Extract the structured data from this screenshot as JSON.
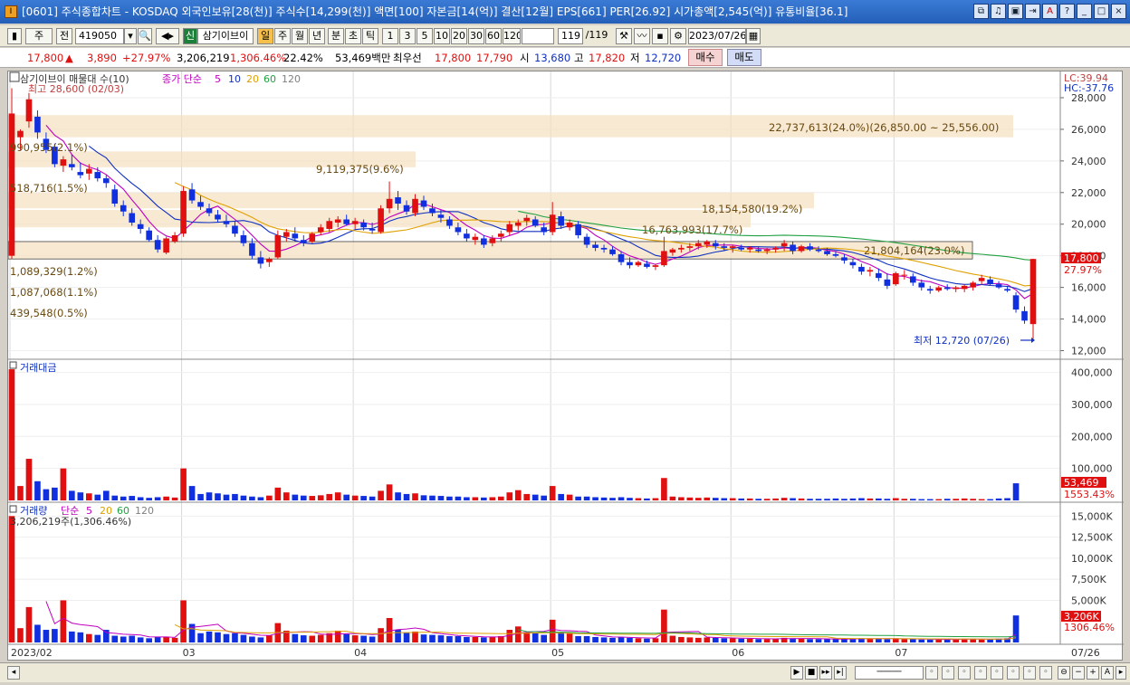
{
  "window": {
    "icon_label": "I",
    "title": "[0601] 주식종합차트 - KOSDAQ 외국인보유[28(천)] 주식수[14,299(천)] 액면[100] 자본금[14(억)] 결산[12월] EPS[661] PER[26.92] 시가총액[2,545(억)] 유통비율[36.1]",
    "buttons": [
      "⧉",
      "♫",
      "▣",
      "⇥",
      "A",
      "?",
      "_",
      "□",
      "×"
    ]
  },
  "toolbar": {
    "period_select": "주",
    "prev_label": "전",
    "code": "419050",
    "code_dropdown": "▾",
    "search": "🔍",
    "speaker": "◀▸",
    "credit_label": "신",
    "stock_name": "삼기이브이",
    "periods": [
      "일",
      "주",
      "월",
      "년",
      "분",
      "초",
      "틱"
    ],
    "selected_period": "일",
    "intervals": [
      "1",
      "3",
      "5",
      "10",
      "20",
      "30",
      "60",
      "120"
    ],
    "count": "119",
    "count_total": "/119",
    "date": "2023/07/26",
    "calendar": "▦"
  },
  "quote": {
    "price": "17,800",
    "arrow": "▲",
    "change": "3,890",
    "change_pct": "+27.97%",
    "volume": "3,206,219",
    "volume_ratio": "1,306.46%",
    "turnover": "22.42%",
    "amount": "53,469백만",
    "best_ask_label": "최우선",
    "best_ask": "17,800",
    "best_bid": "17,790",
    "open_label": "시",
    "open": "13,680",
    "high_label": "고",
    "high": "17,820",
    "low_label": "저",
    "low": "12,720",
    "buy": "매수",
    "sell": "매도"
  },
  "price_panel": {
    "legend_name": "삼기이브이 매물대 수(10)",
    "legend_ma": "종가 단순",
    "ma_periods": [
      "5",
      "10",
      "20",
      "60",
      "120"
    ],
    "ma_colors": [
      "#c000c0",
      "#1030c0",
      "#e0a000",
      "#20a040",
      "#808080"
    ],
    "high_marker": "최고 28,600 (02/03)",
    "low_marker": "최저 12,720 (07/26)",
    "lc": "LC:39.94",
    "hc": "HC:-37.76",
    "last_price_tag": "17,800",
    "last_pct_tag": "27.97%",
    "volume_profile_labels": [
      "22,737,613(24.0%)(26,850.00 ~ 25,556.00)",
      "9,119,375(9.6%)",
      "18,154,580(19.2%)",
      "16,763,993(17.7%)",
      "21,804,164(23.0%)"
    ],
    "left_profile_labels": [
      "990,955(2.1%)",
      "518,716(1.5%)",
      "1,089,329(1.2%)",
      "1,087,068(1.1%)",
      "439,548(0.5%)"
    ]
  },
  "amount_panel": {
    "title": "거래대금",
    "last_tag": "53,469",
    "last_pct": "1553.43%"
  },
  "volume_panel": {
    "legend_name": "거래량",
    "legend_ma": "단순",
    "ma_periods": [
      "5",
      "20",
      "60",
      "120"
    ],
    "last_label": "3,206,219주(1,306.46%)",
    "last_tag": "3,206K",
    "last_pct": "1306.46%"
  },
  "chart_data": {
    "type": "candlestick",
    "x_labels": [
      "2023/02",
      "03",
      "04",
      "05",
      "06",
      "07",
      "07/26"
    ],
    "price_axis": {
      "ticks": [
        12000,
        14000,
        16000,
        18000,
        20000,
        22000,
        24000,
        26000,
        28000
      ],
      "tick_labels": [
        "12,000",
        "14,000",
        "16,000",
        "18,000",
        "20,000",
        "22,000",
        "24,000",
        "26,000",
        "28,000"
      ],
      "range": [
        11800,
        29200
      ]
    },
    "amount_axis": {
      "ticks": [
        100000,
        200000,
        300000,
        400000
      ],
      "tick_labels": [
        "100,000",
        "200,000",
        "300,000",
        "400,000"
      ],
      "range": [
        0,
        430000
      ]
    },
    "volume_axis": {
      "ticks": [
        5000,
        7500,
        10000,
        12500,
        15000
      ],
      "tick_labels": [
        "5,000K",
        "7,500K",
        "10,000K",
        "12,500K",
        "15,000K"
      ],
      "range": [
        0,
        16000
      ]
    },
    "candles": [
      [
        18000,
        28600,
        17800,
        27000
      ],
      [
        25500,
        26000,
        24700,
        25900
      ],
      [
        26500,
        28300,
        26100,
        27900
      ],
      [
        26800,
        27200,
        25400,
        25800
      ],
      [
        25400,
        25800,
        24500,
        24700
      ],
      [
        24900,
        25100,
        23600,
        23800
      ],
      [
        23700,
        24300,
        23300,
        24100
      ],
      [
        23800,
        24400,
        23400,
        23600
      ],
      [
        23300,
        23900,
        22900,
        23100
      ],
      [
        23200,
        23800,
        22800,
        23500
      ],
      [
        23300,
        23600,
        22700,
        22900
      ],
      [
        22900,
        23100,
        22300,
        22600
      ],
      [
        22200,
        22500,
        21100,
        21300
      ],
      [
        21200,
        21500,
        20500,
        20800
      ],
      [
        20700,
        21000,
        19900,
        20100
      ],
      [
        20000,
        20300,
        19400,
        19700
      ],
      [
        19600,
        19800,
        18900,
        19000
      ],
      [
        19000,
        19300,
        18200,
        18400
      ],
      [
        18200,
        19200,
        18100,
        19100
      ],
      [
        18900,
        19500,
        18800,
        19300
      ],
      [
        19400,
        22400,
        19200,
        22100
      ],
      [
        22200,
        22600,
        21300,
        21500
      ],
      [
        21400,
        21800,
        20900,
        21100
      ],
      [
        21000,
        21300,
        20500,
        20700
      ],
      [
        20600,
        20900,
        20100,
        20300
      ],
      [
        20200,
        20600,
        19800,
        20000
      ],
      [
        19900,
        20200,
        19200,
        19400
      ],
      [
        19300,
        19600,
        18600,
        18800
      ],
      [
        18800,
        19100,
        17800,
        18000
      ],
      [
        17900,
        18300,
        17200,
        17500
      ],
      [
        17600,
        17900,
        17300,
        17800
      ],
      [
        17900,
        19600,
        17800,
        19300
      ],
      [
        19200,
        19700,
        18900,
        19500
      ],
      [
        19400,
        19800,
        18900,
        19100
      ],
      [
        19000,
        19300,
        18600,
        18800
      ],
      [
        18900,
        19500,
        18800,
        19400
      ],
      [
        19500,
        20000,
        19300,
        19800
      ],
      [
        19700,
        20400,
        19500,
        20200
      ],
      [
        20100,
        20500,
        19800,
        20300
      ],
      [
        20300,
        20600,
        19900,
        20000
      ],
      [
        20000,
        20400,
        19700,
        20200
      ],
      [
        20100,
        20300,
        19600,
        19800
      ],
      [
        19700,
        20100,
        19400,
        19600
      ],
      [
        19500,
        21200,
        19400,
        21000
      ],
      [
        21000,
        22700,
        20700,
        21600
      ],
      [
        21700,
        22100,
        20900,
        21300
      ],
      [
        21200,
        21500,
        20600,
        20800
      ],
      [
        20700,
        21900,
        20500,
        21600
      ],
      [
        21500,
        21800,
        20900,
        21100
      ],
      [
        21000,
        21300,
        20500,
        20700
      ],
      [
        20600,
        20900,
        20100,
        20400
      ],
      [
        20300,
        20500,
        19700,
        19900
      ],
      [
        19800,
        20100,
        19300,
        19500
      ],
      [
        19400,
        19700,
        18900,
        19100
      ],
      [
        19000,
        19400,
        18700,
        19200
      ],
      [
        19100,
        19300,
        18500,
        18700
      ],
      [
        18800,
        19300,
        18600,
        19100
      ],
      [
        19200,
        19600,
        18900,
        19400
      ],
      [
        19500,
        20200,
        19300,
        20000
      ],
      [
        19900,
        20300,
        19600,
        20100
      ],
      [
        20200,
        20600,
        19900,
        20400
      ],
      [
        20300,
        20500,
        19800,
        19900
      ],
      [
        19800,
        20100,
        19300,
        19500
      ],
      [
        19500,
        21400,
        19300,
        20600
      ],
      [
        20500,
        20800,
        19700,
        19900
      ],
      [
        19800,
        20300,
        19600,
        20100
      ],
      [
        20000,
        20200,
        19100,
        19300
      ],
      [
        19200,
        19400,
        18500,
        18700
      ],
      [
        18700,
        18900,
        18300,
        18500
      ],
      [
        18500,
        18700,
        18200,
        18400
      ],
      [
        18400,
        18600,
        18000,
        18100
      ],
      [
        18100,
        18300,
        17400,
        17600
      ],
      [
        17600,
        17900,
        17200,
        17400
      ],
      [
        17400,
        17700,
        17300,
        17600
      ],
      [
        17500,
        17700,
        17200,
        17300
      ],
      [
        17300,
        17500,
        17100,
        17400
      ],
      [
        17400,
        19200,
        17300,
        18300
      ],
      [
        18200,
        18500,
        18000,
        18400
      ],
      [
        18400,
        18700,
        18200,
        18500
      ],
      [
        18500,
        18800,
        18300,
        18600
      ],
      [
        18600,
        19000,
        18400,
        18800
      ],
      [
        18700,
        19000,
        18500,
        18900
      ],
      [
        18800,
        19000,
        18400,
        18600
      ],
      [
        18600,
        18800,
        18300,
        18500
      ],
      [
        18500,
        18700,
        18200,
        18600
      ],
      [
        18500,
        18700,
        18300,
        18400
      ],
      [
        18400,
        18600,
        18200,
        18500
      ],
      [
        18400,
        18600,
        18200,
        18300
      ],
      [
        18300,
        18500,
        18100,
        18400
      ],
      [
        18400,
        18600,
        18200,
        18500
      ],
      [
        18600,
        19000,
        18300,
        18800
      ],
      [
        18700,
        18900,
        18100,
        18300
      ],
      [
        18300,
        18700,
        18200,
        18600
      ],
      [
        18600,
        18800,
        18300,
        18400
      ],
      [
        18400,
        18600,
        18200,
        18300
      ],
      [
        18300,
        18500,
        18000,
        18100
      ],
      [
        18100,
        18300,
        17900,
        18000
      ],
      [
        17900,
        18100,
        17500,
        17700
      ],
      [
        17600,
        17800,
        17200,
        17400
      ],
      [
        17300,
        17500,
        16800,
        17000
      ],
      [
        17000,
        17300,
        16700,
        17100
      ],
      [
        16900,
        17200,
        16400,
        16600
      ],
      [
        16500,
        16900,
        15900,
        16100
      ],
      [
        16200,
        17000,
        16100,
        16900
      ],
      [
        16800,
        17100,
        16500,
        16800
      ],
      [
        16700,
        16900,
        16100,
        16300
      ],
      [
        16300,
        16500,
        15800,
        16000
      ],
      [
        15900,
        16100,
        15600,
        15800
      ],
      [
        15800,
        16100,
        15700,
        16000
      ],
      [
        16000,
        16200,
        15800,
        15900
      ],
      [
        15900,
        16100,
        15700,
        16000
      ],
      [
        15900,
        16200,
        15700,
        16100
      ],
      [
        16000,
        16400,
        15800,
        16300
      ],
      [
        16400,
        16800,
        16200,
        16600
      ],
      [
        16500,
        16700,
        16100,
        16200
      ],
      [
        16200,
        16400,
        15900,
        16000
      ],
      [
        15900,
        16100,
        15700,
        15800
      ],
      [
        15500,
        15700,
        14400,
        14600
      ],
      [
        14500,
        14800,
        13700,
        13900
      ],
      [
        13680,
        17820,
        12720,
        17800
      ]
    ],
    "amount_values": [
      410000,
      45000,
      130000,
      60000,
      35000,
      40000,
      100000,
      30000,
      25000,
      22000,
      18000,
      30000,
      15000,
      12000,
      14000,
      10000,
      8000,
      10000,
      12000,
      9000,
      100000,
      45000,
      20000,
      25000,
      22000,
      18000,
      20000,
      15000,
      12000,
      10000,
      15000,
      40000,
      25000,
      18000,
      15000,
      14000,
      16000,
      20000,
      25000,
      18000,
      15000,
      14000,
      12000,
      30000,
      50000,
      25000,
      20000,
      22000,
      16000,
      15000,
      14000,
      12000,
      12000,
      10000,
      10000,
      9000,
      10000,
      12000,
      25000,
      32000,
      20000,
      18000,
      15000,
      45000,
      20000,
      18000,
      12000,
      12000,
      10000,
      9000,
      8000,
      10000,
      8000,
      7000,
      6000,
      7000,
      70000,
      12000,
      10000,
      9000,
      8000,
      9000,
      8000,
      7000,
      7000,
      6000,
      6000,
      5000,
      5000,
      6000,
      8000,
      7000,
      6000,
      5000,
      5000,
      5000,
      6000,
      5000,
      6000,
      7000,
      6000,
      6000,
      5000,
      7000,
      5000,
      5000,
      4000,
      4000,
      4000,
      5000,
      5000,
      6000,
      5000,
      4000,
      4000,
      6000,
      7000,
      53469
    ],
    "volume_values": [
      15000,
      1700,
      4200,
      2100,
      1500,
      1600,
      5000,
      1300,
      1200,
      1000,
      900,
      1500,
      800,
      700,
      800,
      600,
      500,
      650,
      700,
      550,
      5000,
      2200,
      1100,
      1300,
      1200,
      1000,
      1100,
      900,
      700,
      600,
      850,
      2300,
      1400,
      1000,
      850,
      800,
      900,
      1100,
      1400,
      1000,
      850,
      800,
      700,
      1700,
      2900,
      1500,
      1200,
      1300,
      950,
      900,
      850,
      750,
      750,
      650,
      650,
      600,
      650,
      750,
      1500,
      1900,
      1200,
      1100,
      900,
      2700,
      1200,
      1100,
      750,
      750,
      650,
      600,
      550,
      650,
      550,
      500,
      450,
      500,
      3900,
      800,
      650,
      600,
      550,
      600,
      550,
      500,
      500,
      450,
      450,
      400,
      400,
      450,
      550,
      500,
      450,
      400,
      400,
      400,
      450,
      400,
      450,
      500,
      450,
      450,
      400,
      500,
      400,
      400,
      350,
      350,
      350,
      400,
      400,
      450,
      400,
      350,
      350,
      450,
      500,
      3206
    ]
  }
}
